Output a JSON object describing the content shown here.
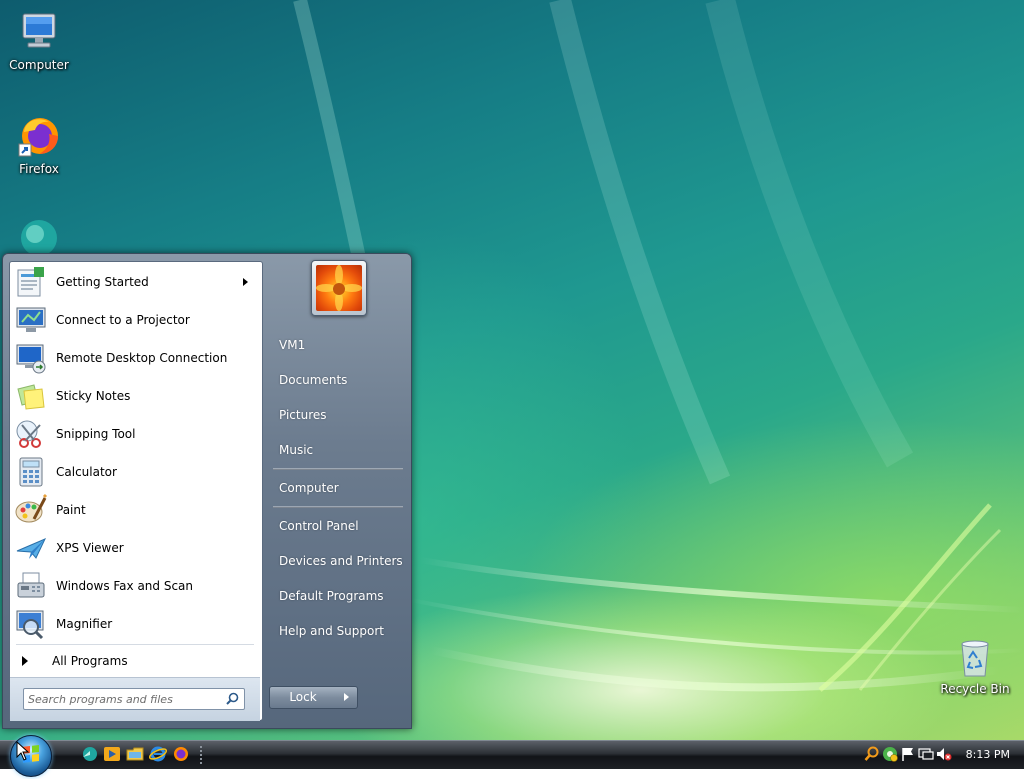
{
  "desktop": {
    "icons": [
      {
        "label": "Computer"
      },
      {
        "label": "Firefox"
      },
      {
        "label": "Recycle Bin"
      }
    ]
  },
  "start_menu": {
    "programs": [
      {
        "label": "Getting Started",
        "icon": "getting-started-icon",
        "has_submenu": true
      },
      {
        "label": "Connect to a Projector",
        "icon": "projector-icon"
      },
      {
        "label": "Remote Desktop Connection",
        "icon": "remote-desktop-icon"
      },
      {
        "label": "Sticky Notes",
        "icon": "sticky-notes-icon"
      },
      {
        "label": "Snipping Tool",
        "icon": "snipping-tool-icon"
      },
      {
        "label": "Calculator",
        "icon": "calculator-icon"
      },
      {
        "label": "Paint",
        "icon": "paint-icon"
      },
      {
        "label": "XPS Viewer",
        "icon": "xps-viewer-icon"
      },
      {
        "label": "Windows Fax and Scan",
        "icon": "fax-scan-icon"
      },
      {
        "label": "Magnifier",
        "icon": "magnifier-icon"
      }
    ],
    "all_programs": "All Programs",
    "search": {
      "placeholder": "Search programs and files"
    },
    "right_items": [
      {
        "label": "VM1"
      },
      {
        "label": "Documents"
      },
      {
        "label": "Pictures"
      },
      {
        "label": "Music"
      },
      {
        "label": "Computer"
      },
      {
        "label": "Control Panel"
      },
      {
        "label": "Devices and Printers"
      },
      {
        "label": "Default Programs"
      },
      {
        "label": "Help and Support"
      }
    ],
    "lock_label": "Lock"
  },
  "taskbar": {
    "quick_launch": [
      "switch-windows-icon",
      "media-player-icon",
      "explorer-icon",
      "internet-explorer-icon",
      "firefox-icon"
    ],
    "tray": [
      "search-icon",
      "network-icon",
      "action-center-flag-icon",
      "display-icon",
      "volume-muted-icon"
    ],
    "clock": "8:13 PM"
  },
  "colors": {
    "menu_frame": "#6c7c8f",
    "taskbar": "#1e2126",
    "desktop_teal": "#1f9890"
  }
}
